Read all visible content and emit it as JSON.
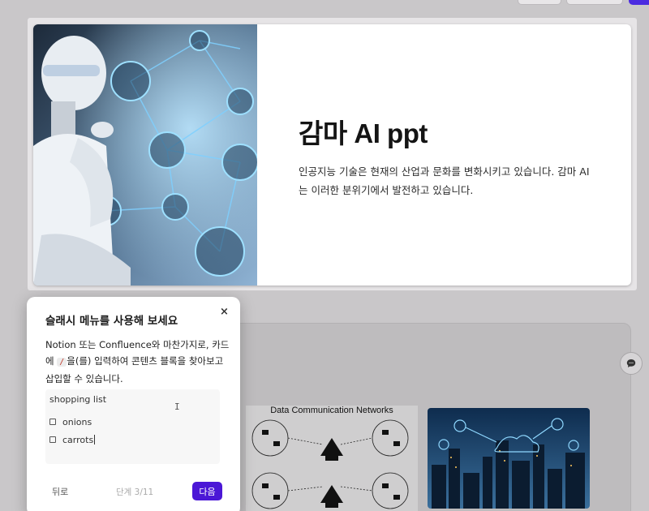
{
  "slide1": {
    "title": "감마 AI ppt",
    "description": "인공지능 기술은 현재의 산업과 문화를 변화시키고 있습니다. 감마 AI는 이러한 분위기에서 발전하고 있습니다.",
    "image_icon": "robot-network-image"
  },
  "slide2": {
    "diagram_title": "Data Communication Networks",
    "comment_icon": "comment-icon"
  },
  "popup": {
    "title": "슬래시 메뉴를 사용해 보세요",
    "close_label": "×",
    "body_before": "Notion 또는 Confluence와 마찬가지로, 카드에",
    "slash": "/",
    "body_after": "을(를) 입력하여 콘텐츠 블록을 찾아보고 삽입할 수 있습니다.",
    "demo_heading": "shopping list",
    "todos": [
      "onions",
      "carrots"
    ],
    "back_label": "뒤로",
    "step_label": "단계 3/11",
    "next_label": "다음"
  },
  "colors": {
    "accent": "#4b17d6",
    "background": "#c9c7c9"
  }
}
